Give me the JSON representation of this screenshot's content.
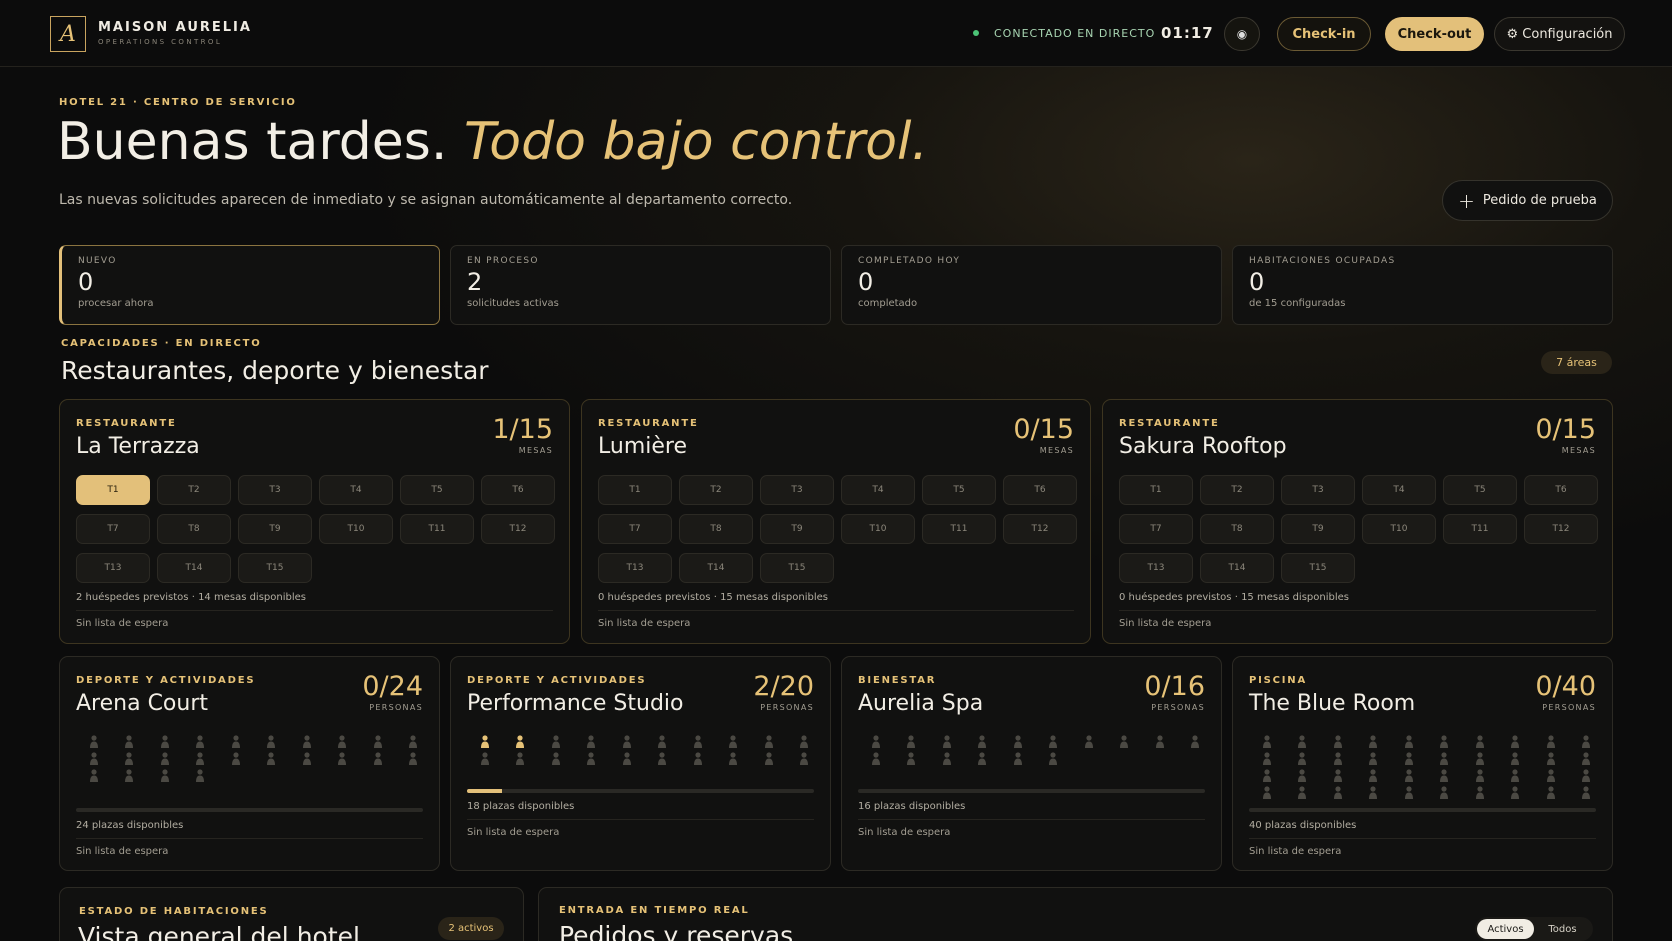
{
  "header": {
    "logo_letter": "A",
    "brand": "MAISON AURELIA",
    "brand_sub": "OPERATIONS CONTROL",
    "live_status": "CONECTADO EN DIRECTO",
    "clock": "01:17",
    "theme_icon": "◉",
    "checkin": "Check-in",
    "checkout": "Check-out",
    "config": "⚙ Configuración"
  },
  "hero": {
    "eyebrow": "HOTEL 21 · CENTRO DE SERVICIO",
    "title": "Buenas tardes.",
    "title_accent": "Todo bajo control.",
    "subtitle": "Las nuevas solicitudes aparecen de inmediato y se asignan automáticamente al departamento correcto.",
    "test_order": "Pedido de prueba"
  },
  "stats": [
    {
      "label": "NUEVO",
      "value": "0",
      "note": "procesar ahora"
    },
    {
      "label": "EN PROCESO",
      "value": "2",
      "note": "solicitudes activas"
    },
    {
      "label": "COMPLETADO HOY",
      "value": "0",
      "note": "completado"
    },
    {
      "label": "HABITACIONES OCUPADAS",
      "value": "0",
      "note": "de 15 configuradas"
    }
  ],
  "capacity": {
    "eyebrow": "CAPACIDADES · EN DIRECTO",
    "title": "Restaurantes, deporte y bienestar",
    "areas_badge": "7 áreas"
  },
  "restaurants": [
    {
      "type": "RESTAURANTE",
      "name": "La Terrazza",
      "count": "1/15",
      "unit": "MESAS",
      "tables": [
        "T1",
        "T2",
        "T3",
        "T4",
        "T5",
        "T6",
        "T7",
        "T8",
        "T9",
        "T10",
        "T11",
        "T12",
        "T13",
        "T14",
        "T15"
      ],
      "occupied_tables": [
        "T1"
      ],
      "guests": "2 huéspedes previstos",
      "available": "14 mesas disponibles",
      "waitlist": "Sin lista de espera"
    },
    {
      "type": "RESTAURANTE",
      "name": "Lumière",
      "count": "0/15",
      "unit": "MESAS",
      "tables": [
        "T1",
        "T2",
        "T3",
        "T4",
        "T5",
        "T6",
        "T7",
        "T8",
        "T9",
        "T10",
        "T11",
        "T12",
        "T13",
        "T14",
        "T15"
      ],
      "occupied_tables": [],
      "guests": "0 huéspedes previstos",
      "available": "15 mesas disponibles",
      "waitlist": "Sin lista de espera"
    },
    {
      "type": "RESTAURANTE",
      "name": "Sakura Rooftop",
      "count": "0/15",
      "unit": "MESAS",
      "tables": [
        "T1",
        "T2",
        "T3",
        "T4",
        "T5",
        "T6",
        "T7",
        "T8",
        "T9",
        "T10",
        "T11",
        "T12",
        "T13",
        "T14",
        "T15"
      ],
      "occupied_tables": [],
      "guests": "0 huéspedes previstos",
      "available": "15 mesas disponibles",
      "waitlist": "Sin lista de espera"
    }
  ],
  "areas": [
    {
      "type": "DEPORTE Y ACTIVIDADES",
      "name": "Arena Court",
      "count": "0/24",
      "unit": "PERSONAS",
      "capacity": 24,
      "occupied": 0,
      "available": "24 plazas disponibles",
      "waitlist": "Sin lista de espera"
    },
    {
      "type": "DEPORTE Y ACTIVIDADES",
      "name": "Performance Studio",
      "count": "2/20",
      "unit": "PERSONAS",
      "capacity": 20,
      "occupied": 2,
      "available": "18 plazas disponibles",
      "waitlist": "Sin lista de espera"
    },
    {
      "type": "BIENESTAR",
      "name": "Aurelia Spa",
      "count": "0/16",
      "unit": "PERSONAS",
      "capacity": 16,
      "occupied": 0,
      "available": "16 plazas disponibles",
      "waitlist": "Sin lista de espera"
    },
    {
      "type": "PISCINA",
      "name": "The Blue Room",
      "count": "0/40",
      "unit": "PERSONAS",
      "capacity": 40,
      "occupied": 0,
      "available": "40 plazas disponibles",
      "waitlist": "Sin lista de espera"
    }
  ],
  "rooms_panel": {
    "eyebrow": "ESTADO DE HABITACIONES",
    "title": "Vista general del hotel",
    "badge": "2 activos"
  },
  "orders_panel": {
    "eyebrow": "ENTRADA EN TIEMPO REAL",
    "title": "Pedidos y reservas",
    "filter_active": "Activos",
    "filter_all": "Todos"
  }
}
